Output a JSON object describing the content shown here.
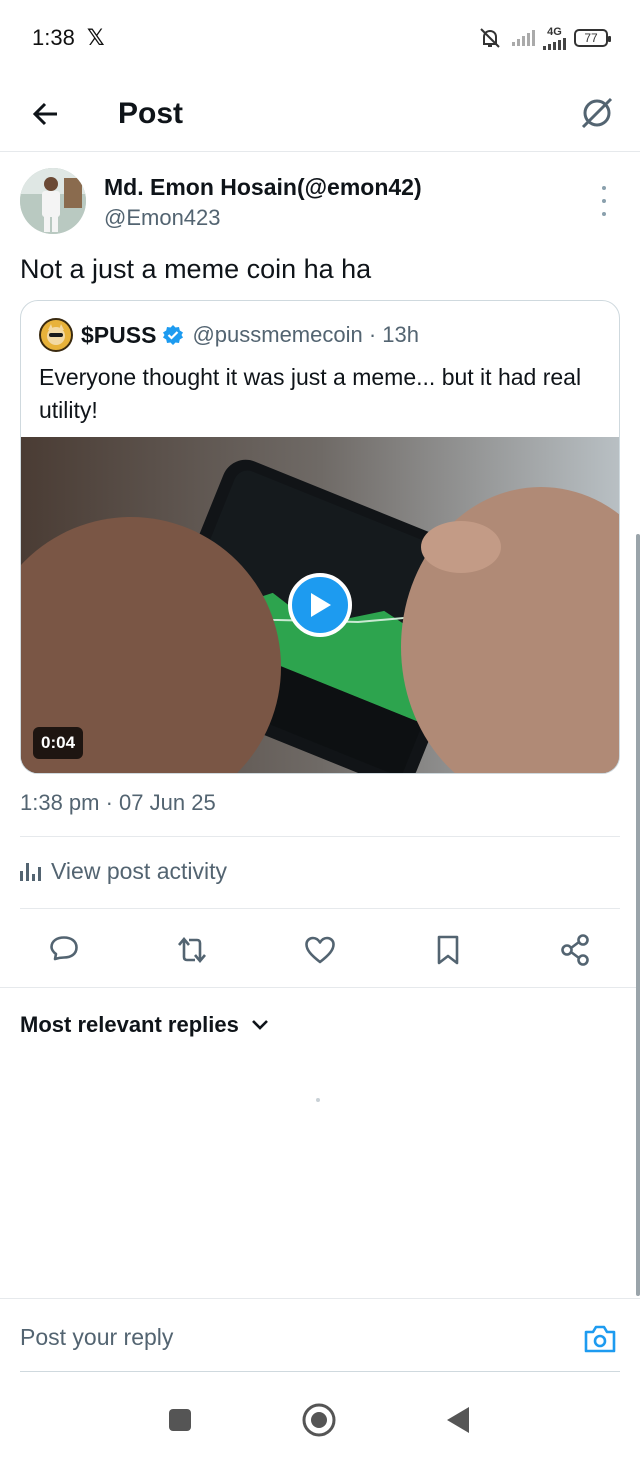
{
  "status_bar": {
    "time": "1:38",
    "app_icon": "x-logo-icon",
    "network_label": "4G",
    "battery": "77"
  },
  "header": {
    "title": "Post",
    "back_icon": "arrow-left-icon",
    "grok_icon": "grok-icon"
  },
  "post": {
    "author_name": "Md. Emon Hosain(@emon42)",
    "author_handle": "@Emon423",
    "text": "Not a just a meme coin ha ha",
    "timestamp": "1:38 pm · 07 Jun 25",
    "view_activity": "View post activity"
  },
  "quote": {
    "name": "$PUSS",
    "handle": "@pussmemecoin · 13h",
    "text": "Everyone thought it was just a meme... but it had real utility!",
    "video_duration": "0:04",
    "verified_color": "#1d9bf0"
  },
  "actions": [
    {
      "name": "reply-icon"
    },
    {
      "name": "repost-icon"
    },
    {
      "name": "like-icon"
    },
    {
      "name": "bookmark-icon"
    },
    {
      "name": "share-icon"
    }
  ],
  "replies": {
    "sort_label": "Most relevant replies"
  },
  "composer": {
    "placeholder": "Post your reply"
  },
  "colors": {
    "accent": "#1d9bf0",
    "secondary_text": "#536471",
    "primary_text": "#0f1419"
  }
}
